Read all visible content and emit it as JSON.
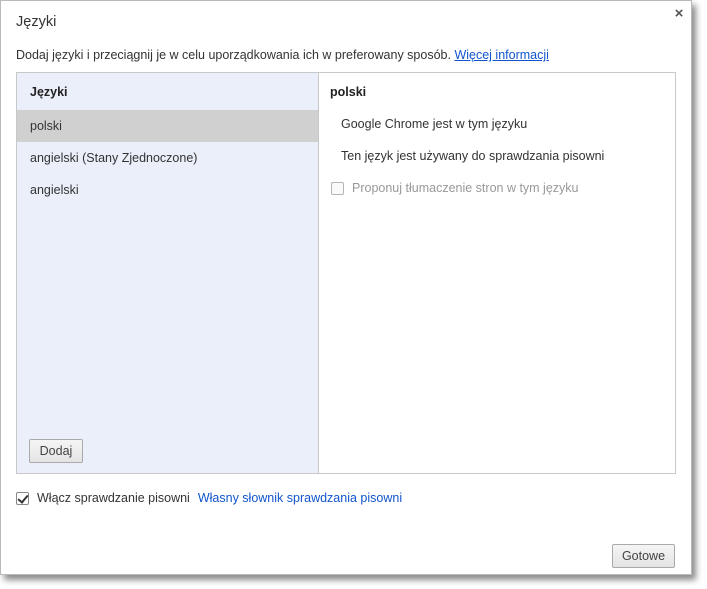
{
  "dialog": {
    "title": "Języki",
    "close_glyph": "×",
    "description": "Dodaj języki i przeciągnij je w celu uporządkowania ich w preferowany sposób.",
    "more_info_link": "Więcej informacji"
  },
  "languages": {
    "header": "Języki",
    "items": [
      {
        "label": "polski",
        "selected": true
      },
      {
        "label": "angielski (Stany Zjednoczone)",
        "selected": false
      },
      {
        "label": "angielski",
        "selected": false
      }
    ],
    "add_button": "Dodaj"
  },
  "details": {
    "header": "polski",
    "line1": "Google Chrome jest w tym języku",
    "line2": "Ten język jest używany do sprawdzania pisowni",
    "translate_checkbox": {
      "label": "Proponuj tłumaczenie stron w tym języku",
      "checked": false,
      "disabled": true
    }
  },
  "spellcheck": {
    "label": "Włącz sprawdzanie pisowni",
    "checked": true,
    "custom_dictionary_link": "Własny słownik sprawdzania pisowni"
  },
  "footer": {
    "done_button": "Gotowe"
  },
  "colors": {
    "link": "#1155cc",
    "list_background": "#ebeff9",
    "selected_item": "#d0d0d0"
  }
}
